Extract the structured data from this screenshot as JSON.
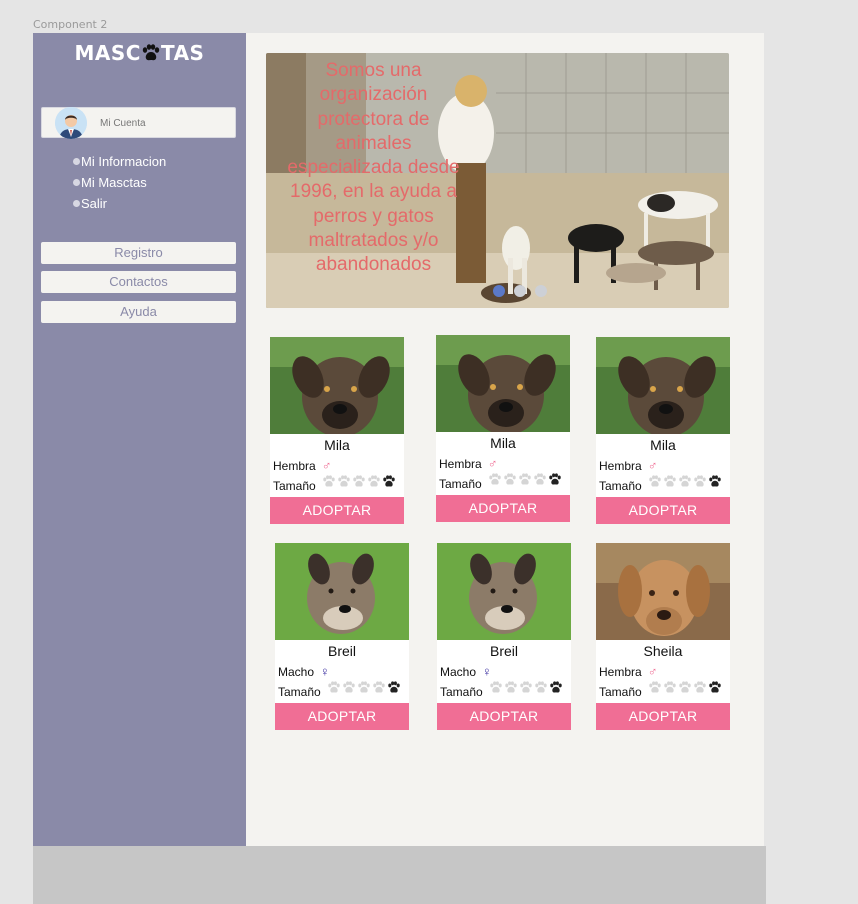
{
  "frame_label": "Component 2",
  "logo": {
    "text_before": "MASC",
    "text_after": "TAS"
  },
  "account": {
    "label": "Mi Cuenta"
  },
  "menu": {
    "items": [
      "Mi Informacion",
      "Mi Masctas",
      "Salir"
    ]
  },
  "nav": {
    "items": [
      "Registro",
      "Contactos",
      "Ayuda"
    ]
  },
  "hero": {
    "text": "Somos una organización protectora de animales especializada desde 1996, en la ayuda a perros y gatos maltratados y/o abandonados",
    "slides": 3,
    "active_slide": 1
  },
  "labels": {
    "size": "Tamaño",
    "adopt": "ADOPTAR"
  },
  "pets": [
    {
      "name": "Mila",
      "sex": "Hembra",
      "sex_icon": "♂",
      "sex_color": "#f06e95",
      "size_level": 1
    },
    {
      "name": "Mila",
      "sex": "Hembra",
      "sex_icon": "♂",
      "sex_color": "#f06e95",
      "size_level": 1
    },
    {
      "name": "Mila",
      "sex": "Hembra",
      "sex_icon": "♂",
      "sex_color": "#f06e95",
      "size_level": 1
    },
    {
      "name": "Breil",
      "sex": "Macho",
      "sex_icon": "♀",
      "sex_color": "#3a2fa0",
      "size_level": 1
    },
    {
      "name": "Breil",
      "sex": "Macho",
      "sex_icon": "♀",
      "sex_color": "#3a2fa0",
      "size_level": 1
    },
    {
      "name": "Sheila",
      "sex": "Hembra",
      "sex_icon": "♂",
      "sex_color": "#f06e95",
      "size_level": 1
    }
  ],
  "colors": {
    "sidebar": "#8a8aa8",
    "accent": "#f06e95",
    "hero_text": "#e46a6a",
    "active_dot": "#5b79c7"
  }
}
